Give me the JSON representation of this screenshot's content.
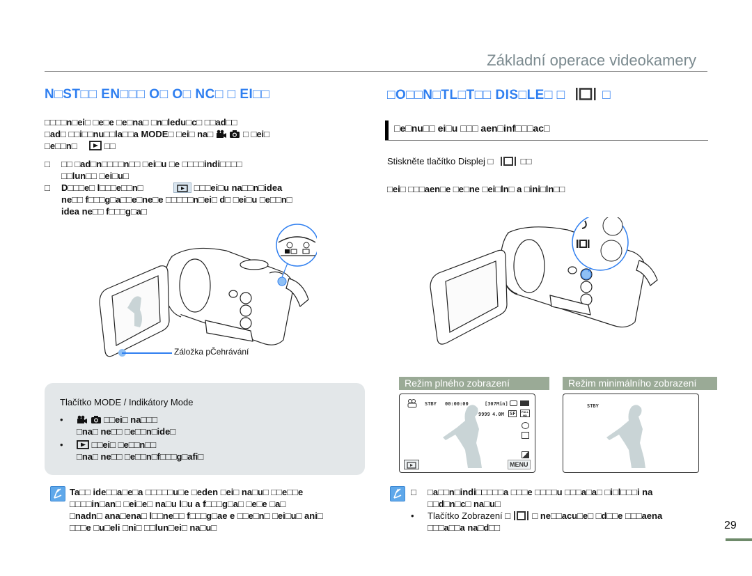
{
  "header": {
    "chapter_title": "Základní operace videokamery"
  },
  "left_section": {
    "title": "N□ST□□ EN□□□ O□ O□ NC□ □ EI□□",
    "intro_lines": [
      "□□□□n□ei□ □e□e □e□na□ □n□ledu□c□ □□ad□□",
      "□ad□ □□i□□nu□□la□□a MODE□ □ei□ na□",
      "□e□□n□"
    ],
    "intro_line2_tail": "□ □ei□",
    "intro_line3_tail": "□□",
    "bullets": [
      {
        "mark": "□",
        "lines": [
          "□□ □ad□n□□□□n□□ □ei□u □e □□□□indi□□□□",
          "□□lun□□ □ei□u□"
        ]
      },
      {
        "mark": "□",
        "lines": [
          "D□□□e□ l□□□e□□n□",
          "ne□□ f□□□g□a□□e□ne□e □□□□□n□ei□ d□ □ei□u □e□□n□",
          "idea ne□□ f□□□g□a□"
        ],
        "line1_tail": "□□□ei□u na□□n□idea"
      }
    ],
    "caption": "Záložka pČehrávání",
    "mode_box": {
      "title": "Tlačítko MODE / Indikátory Mode",
      "items": [
        {
          "line1": "□□ei□ na□□□",
          "line2": "□na□ ne□□ □e□□n□ide□",
          "icon": "video-photo-mode-icon"
        },
        {
          "line1": "□□ei□ □e□□n□□",
          "line2": "□na□ ne□□ □e□□n□f□□□g□afi□",
          "icon": "playback-mode-icon"
        }
      ]
    },
    "note_lines": [
      "Ta□□ ide□□a□e□a □□□□□u□e □eden □ei□ na□u□ □□e□□e",
      "□□□□in□an□ □ei□e□ na□u l□u a f□□□g□a□ □e□e □a□",
      "□nadn□ ana□ena□ l□□ne□□ f□□□g□ae e □□e□n□ □ei□u□ ani□",
      "□□□e □u□eli □ni□ □□lun□ei□ na□u□"
    ]
  },
  "right_section": {
    "title": "□O□□N□TL□T□□ DIS□LE□ □",
    "title_tail": "□",
    "subheading": "□e□nu□□ ei□u □□□ aen□inf□□□ac□",
    "instruction": "Stiskněte tlačítko Displej □",
    "instruction_tail": "□□",
    "modes_line": "□ei□ □□□aen□e □e□ne □ei□ln□ a □ini□ln□□",
    "tab_full": "Režim plného zobrazení",
    "tab_min": "Režim minimálního zobrazení",
    "full_screen": {
      "status": "STBY",
      "timecode": "00:00:00",
      "remaining": "[307Min]",
      "count": "9999",
      "resolution": "4.0M",
      "quality": "SF",
      "hd": "FULL HD",
      "menu_label": "MENU"
    },
    "min_screen": {
      "status": "STBY"
    },
    "note_bullets": [
      {
        "mark": "□",
        "lines": [
          "□a□□n□indi□□□□□a □□□e □□□□u □□□a□a□ □i□l□□□i na",
          "□□d□n□c□ na□u□"
        ]
      },
      {
        "mark": "•",
        "lines": [
          "Tlačítko Zobrazení □",
          "□□□a□□a na□d□□"
        ],
        "line1_tail": "□ ne□□acu□e□ □d□□e □□□aena"
      }
    ]
  },
  "page": {
    "number": "29"
  },
  "colors": {
    "accent_blue": "#2f7ff0",
    "tab_green": "#9aaa96",
    "page_bar": "#6e8a6a",
    "mode_box_bg": "#e3e7e9"
  }
}
